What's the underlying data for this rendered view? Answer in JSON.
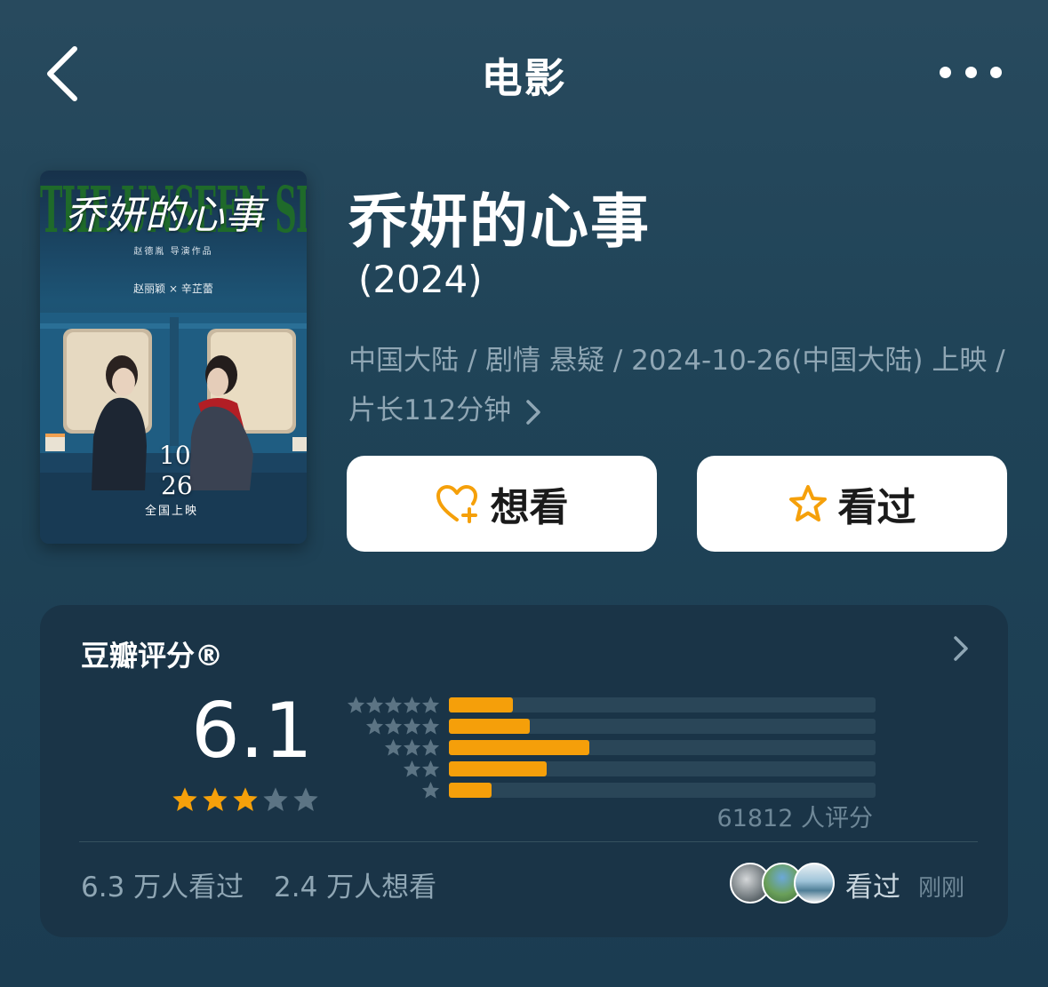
{
  "header": {
    "title": "电影",
    "back_icon": "chevron-left-icon",
    "more_icon": "more-horizontal-icon"
  },
  "poster": {
    "cn_title": "乔妍的心事",
    "en_title": "THE UNSEEN SISTER",
    "director_line": "赵德胤 导演作品",
    "cast": "赵丽颖 × 辛芷蕾",
    "date_month": "10",
    "date_day": "26",
    "release": "全国上映"
  },
  "movie": {
    "title": "乔妍的心事",
    "year": "(2024)",
    "meta": "中国大陆 / 剧情 悬疑 / 2024-10-26(中国大陆) 上映 / 片长112分钟"
  },
  "actions": {
    "want_label": "想看",
    "want_icon": "heart-plus-icon",
    "seen_label": "看过",
    "seen_icon": "star-outline-icon",
    "accent": "#f5a00a"
  },
  "rating": {
    "title": "豆瓣评分®",
    "score": "6.1",
    "stars": 3,
    "distribution": [
      {
        "stars": 5,
        "fraction": 0.15
      },
      {
        "stars": 4,
        "fraction": 0.19
      },
      {
        "stars": 3,
        "fraction": 0.33
      },
      {
        "stars": 2,
        "fraction": 0.23
      },
      {
        "stars": 1,
        "fraction": 0.1
      }
    ],
    "count": "61812 人评分",
    "watched": "6.3 万人看过",
    "wanted": "2.4 万人想看",
    "recent_label": "看过",
    "recent_time": "刚刚",
    "bar_color": "#f59f0a",
    "star_on": "#f5a00a",
    "star_off": "#5c7484"
  }
}
